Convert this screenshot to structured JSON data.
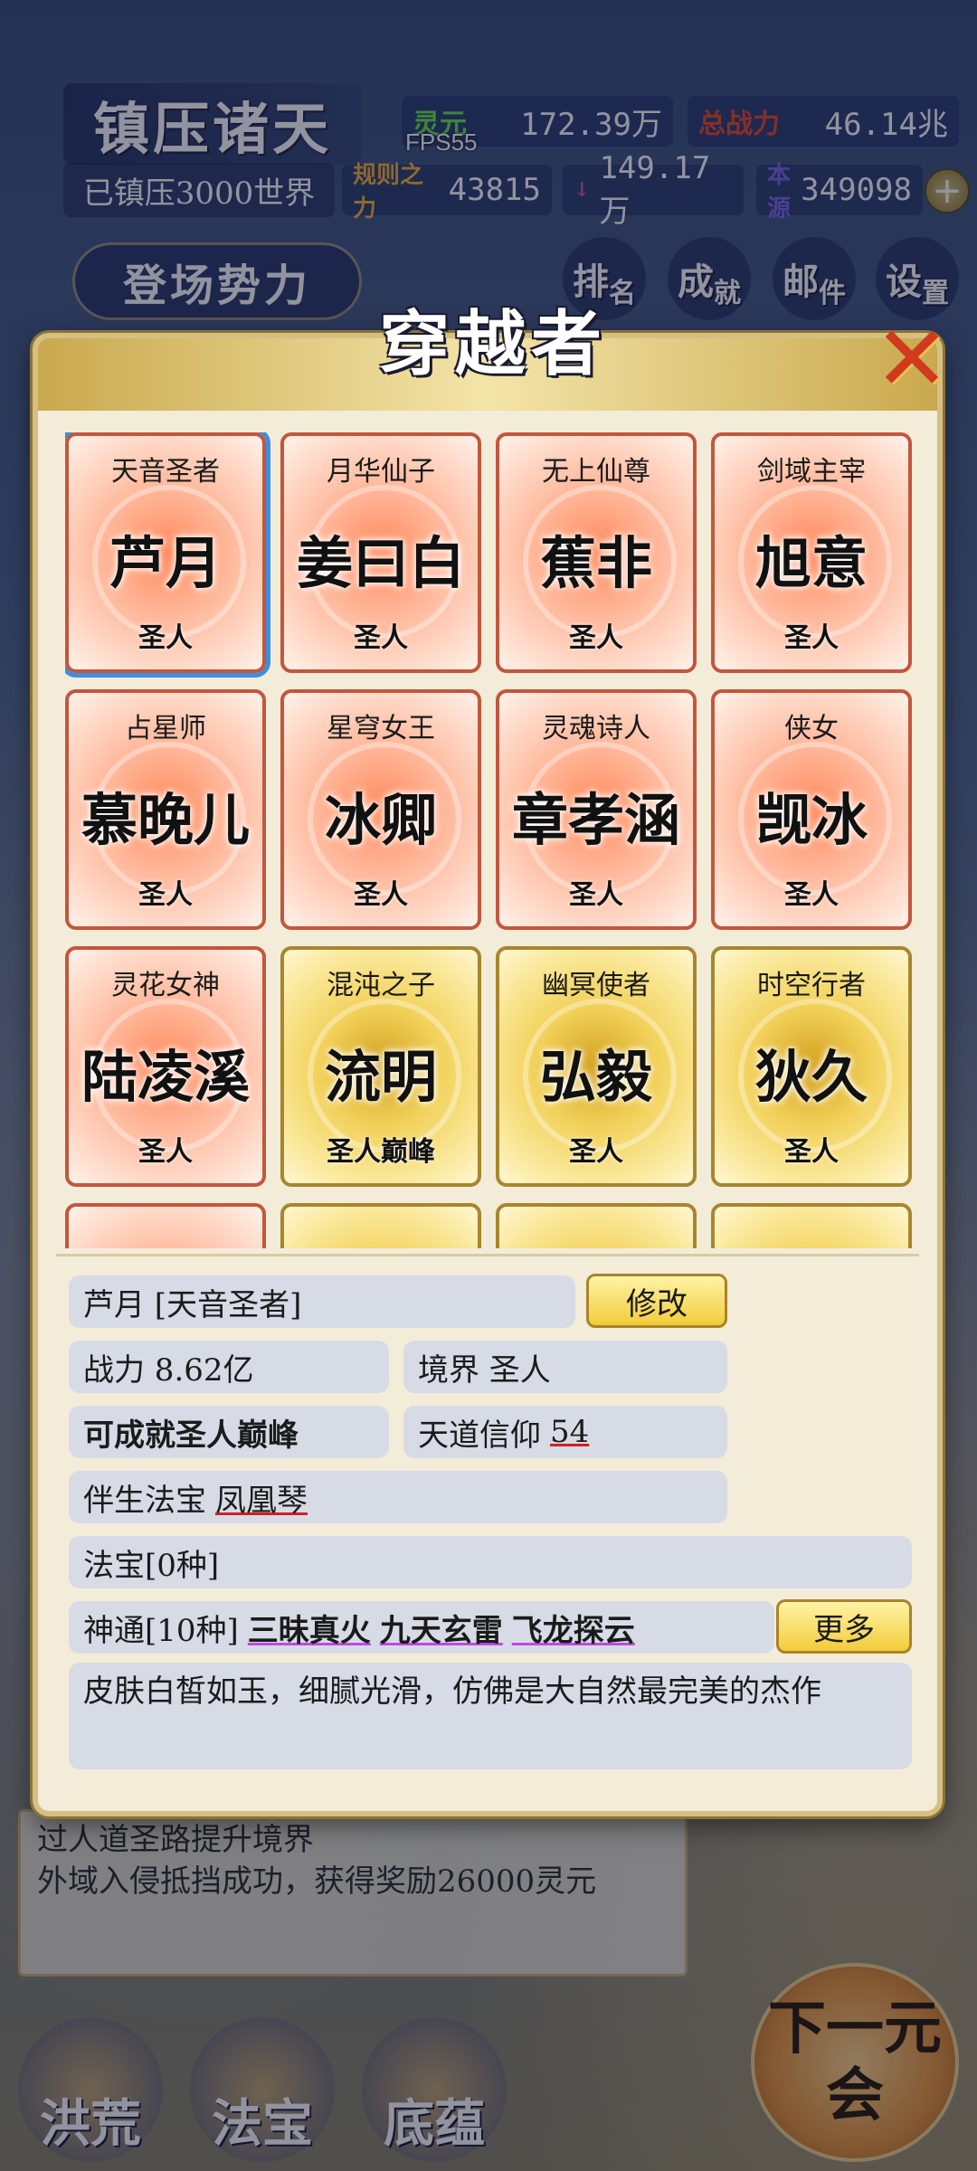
{
  "header": {
    "title": "镇压诸天",
    "subtitle": "已镇压3000世界",
    "fps": "FPS55",
    "stats": {
      "lingyuan_label": "灵元",
      "lingyuan_value": "172.39万",
      "power_label": "总战力",
      "power_value": "46.14兆",
      "rule_label": "规则之力",
      "rule_value": "43815",
      "x_label": "↓",
      "x_value": "149.17万",
      "origin_label": "本源",
      "origin_value": "349098"
    },
    "plus_icon": "+",
    "faction_button": "登场势力",
    "nav": [
      {
        "main": "排",
        "small": "名"
      },
      {
        "main": "成",
        "small": "就"
      },
      {
        "main": "邮",
        "small": "件"
      },
      {
        "main": "设",
        "small": "置"
      }
    ]
  },
  "modal": {
    "title": "穿越者",
    "close_icon": "✕",
    "cards": [
      {
        "title": "天音圣者",
        "name": "芦月",
        "rank": "圣人",
        "style": "red",
        "selected": true
      },
      {
        "title": "月华仙子",
        "name": "姜曰白",
        "rank": "圣人",
        "style": "red"
      },
      {
        "title": "无上仙尊",
        "name": "蕉非",
        "rank": "圣人",
        "style": "red"
      },
      {
        "title": "剑域主宰",
        "name": "旭意",
        "rank": "圣人",
        "style": "red"
      },
      {
        "title": "占星师",
        "name": "慕晚儿",
        "rank": "圣人",
        "style": "red"
      },
      {
        "title": "星穹女王",
        "name": "冰卿",
        "rank": "圣人",
        "style": "red"
      },
      {
        "title": "灵魂诗人",
        "name": "章孝涵",
        "rank": "圣人",
        "style": "red"
      },
      {
        "title": "侠女",
        "name": "觊冰",
        "rank": "圣人",
        "style": "red"
      },
      {
        "title": "灵花女神",
        "name": "陆凌溪",
        "rank": "圣人",
        "style": "red"
      },
      {
        "title": "混沌之子",
        "name": "流明",
        "rank": "圣人巅峰",
        "style": "gold"
      },
      {
        "title": "幽冥使者",
        "name": "弘毅",
        "rank": "圣人",
        "style": "gold"
      },
      {
        "title": "时空行者",
        "name": "狄久",
        "rank": "圣人",
        "style": "gold"
      }
    ],
    "detail": {
      "name_line": "芦月 [天音圣者]",
      "edit_button": "修改",
      "power": "战力 8.62亿",
      "realm": "境界 圣人",
      "potential": "可成就圣人巅峰",
      "faith_label": "天道信仰",
      "faith_value": "54",
      "treasure_label": "伴生法宝",
      "treasure_value": "凤凰琴",
      "artifacts": "法宝[0种]",
      "abilities_label": "神通[10种]",
      "abilities": [
        "三昧真火",
        "九天玄雷",
        "飞龙探云"
      ],
      "more_button": "更多",
      "description": "皮肤白皙如玉，细腻光滑，仿佛是大自然最完美的杰作"
    }
  },
  "log": {
    "line1": "过人道圣路提升境界",
    "line2": "外域入侵抵挡成功，获得奖励26000灵元"
  },
  "bottom": {
    "b1": "洪荒",
    "b2": "法宝",
    "b3": "底蕴",
    "next": "下一元会"
  },
  "colors": {
    "card_red": "#ff8a5c",
    "card_gold": "#f2d15a",
    "selected_border": "#3c8ee0",
    "button_gold": "#f2cc3a"
  }
}
